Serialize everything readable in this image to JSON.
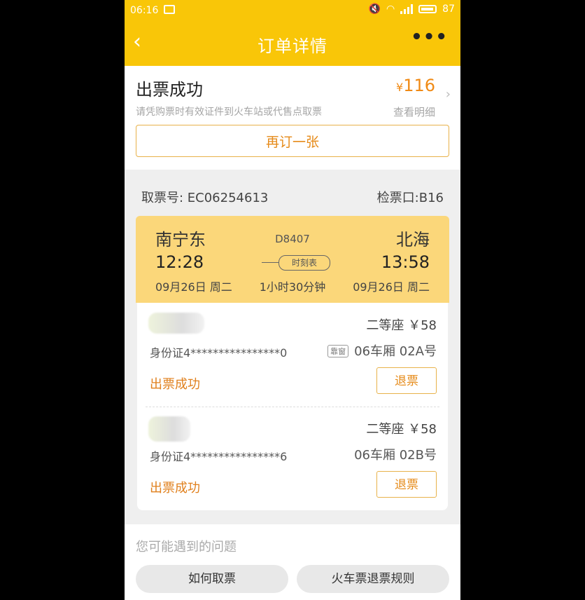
{
  "status_bar": {
    "time": "06:16",
    "battery": "87"
  },
  "header": {
    "back_icon": "chevron-left-icon",
    "title": "订单详情",
    "more_icon": "more-dots-icon",
    "more_label": "•••"
  },
  "order": {
    "status": "出票成功",
    "currency": "¥",
    "total": "116",
    "note": "请凭购票时有效证件到火车站或代售点取票",
    "view_detail": "查看明细",
    "rebook_label": "再订一张"
  },
  "ticket": {
    "pickup_code": "取票号: EC06254613",
    "gate": "检票口:B16",
    "from": "南宁东",
    "to": "北海",
    "train_no": "D8407",
    "dep_time": "12:28",
    "arr_time": "13:58",
    "schedule_label": "时刻表",
    "dep_date": "09月26日 周二",
    "arr_date": "09月26日 周二",
    "duration": "1小时30分钟"
  },
  "passengers": [
    {
      "seat": "二等座 ￥58",
      "id": "身份证4****************0",
      "window_tag": "靠窗",
      "car": "06车厢 02A号",
      "state": "出票成功",
      "refund": "退票"
    },
    {
      "seat": "二等座 ￥58",
      "id": "身份证4****************6",
      "car": "06车厢 02B号",
      "state": "出票成功",
      "refund": "退票"
    }
  ],
  "faq": {
    "heading": "您可能遇到的问题",
    "q1": "如何取票",
    "q2": "火车票退票规则"
  },
  "colors": {
    "accent": "#f9c608",
    "orange": "#e68b1a",
    "route_bg": "#fbd77a"
  }
}
